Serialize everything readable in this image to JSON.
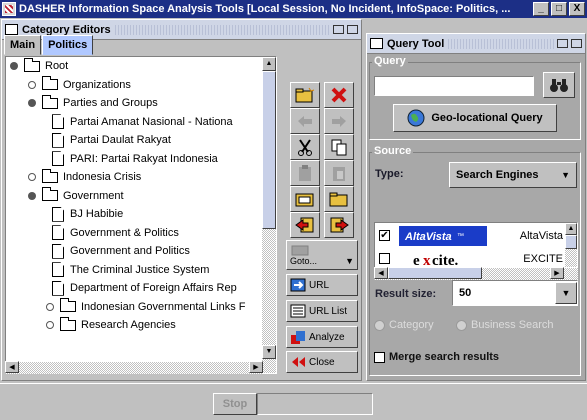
{
  "window": {
    "title": "DASHER Information Space Analysis Tools [Local Session, No Incident, InfoSpace: Politics, ...",
    "controls": [
      "_",
      "□",
      "X"
    ]
  },
  "category_editors": {
    "title": "Category Editors",
    "tabs": [
      "Main",
      "Politics"
    ],
    "tree": [
      {
        "label": "Root",
        "type": "folder",
        "bullet": "filled",
        "level": 0
      },
      {
        "label": "Organizations",
        "type": "folder",
        "bullet": "hollow",
        "level": 1
      },
      {
        "label": "Parties and Groups",
        "type": "folder",
        "bullet": "filled",
        "level": 1
      },
      {
        "label": "Partai Amanat Nasional - Nationa",
        "type": "doc",
        "bullet": "none",
        "level": 2
      },
      {
        "label": "Partai Daulat Rakyat",
        "type": "doc",
        "bullet": "none",
        "level": 2
      },
      {
        "label": "PARI: Partai Rakyat Indonesia",
        "type": "doc",
        "bullet": "none",
        "level": 2
      },
      {
        "label": "Indonesia Crisis",
        "type": "folder",
        "bullet": "hollow",
        "level": 1
      },
      {
        "label": "Government",
        "type": "folder",
        "bullet": "filled",
        "level": 1
      },
      {
        "label": "BJ Habibie",
        "type": "doc",
        "bullet": "none",
        "level": 2
      },
      {
        "label": "Government & Politics",
        "type": "doc",
        "bullet": "none",
        "level": 2
      },
      {
        "label": "Government and Politics",
        "type": "doc",
        "bullet": "none",
        "level": 2
      },
      {
        "label": "The Criminal Justice System",
        "type": "doc",
        "bullet": "none",
        "level": 2
      },
      {
        "label": "Department of Foreign Affairs Rep",
        "type": "doc",
        "bullet": "none",
        "level": 2
      },
      {
        "label": "Indonesian Governmental Links F",
        "type": "folder",
        "bullet": "hollow",
        "level": 2
      },
      {
        "label": "Research Agencies",
        "type": "folder",
        "bullet": "hollow",
        "level": 2
      }
    ],
    "tools": {
      "goto_label": "Goto...",
      "url_label": "URL",
      "url_list_label": "URL List",
      "analyze_label": "Analyze",
      "close_label": "Close"
    }
  },
  "query_tool": {
    "title": "Query Tool",
    "query_group": "Query",
    "query_value": "",
    "geo_button": "Geo-locational Query",
    "source_group": "Source",
    "type_label": "Type:",
    "type_value": "Search Engines",
    "engines": [
      {
        "name": "AltaVista",
        "checked": true,
        "logo": "AltaVista"
      },
      {
        "name": "EXCITE",
        "checked": false,
        "logo": "excite."
      }
    ],
    "result_size_label": "Result size:",
    "result_size_value": "50",
    "radio_category": "Category",
    "radio_business": "Business Search",
    "merge_label": "Merge search results"
  },
  "status": {
    "stop_label": "Stop",
    "status_text": ""
  }
}
